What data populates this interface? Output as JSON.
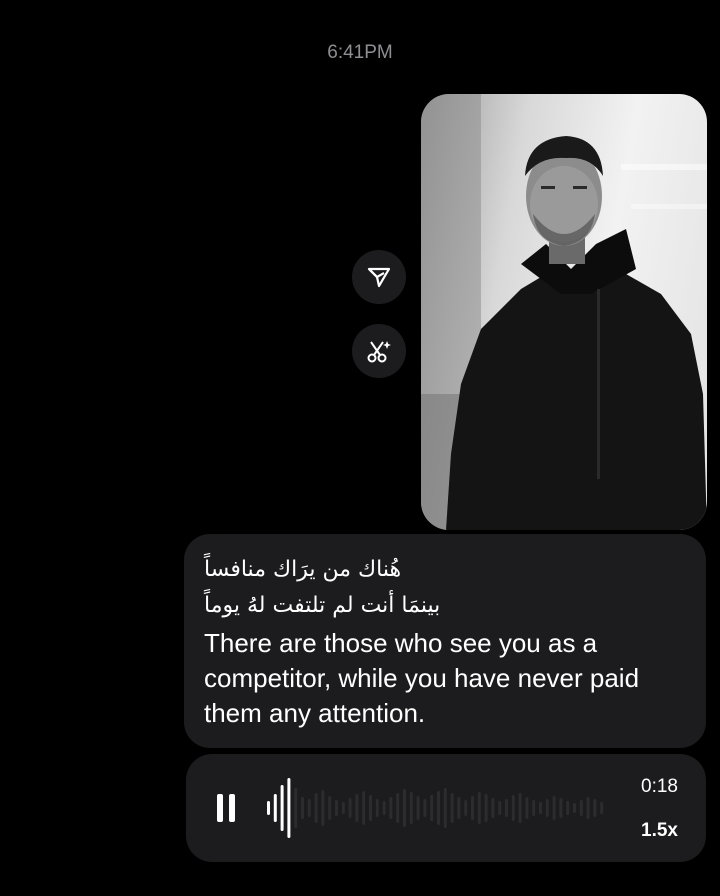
{
  "chat": {
    "timestamp": "6:41PM"
  },
  "message": {
    "arabic_line1": "هُناك من يرَاك منافساً",
    "arabic_line2": "بينمَا أنت لم تلتفت لهُ يوماً",
    "english_text": "There are those who see you as a competitor, while you have never paid them any attention."
  },
  "actions": {
    "share_icon": "send-icon",
    "ai_icon": "ai-sparkle-cut-icon"
  },
  "audio": {
    "duration": "0:18",
    "speed": "1.5x",
    "state": "playing",
    "progress": 0.08
  },
  "colors": {
    "background": "#000000",
    "bubble": "#1c1c1e",
    "text": "#ffffff",
    "muted": "#8e8e93"
  }
}
